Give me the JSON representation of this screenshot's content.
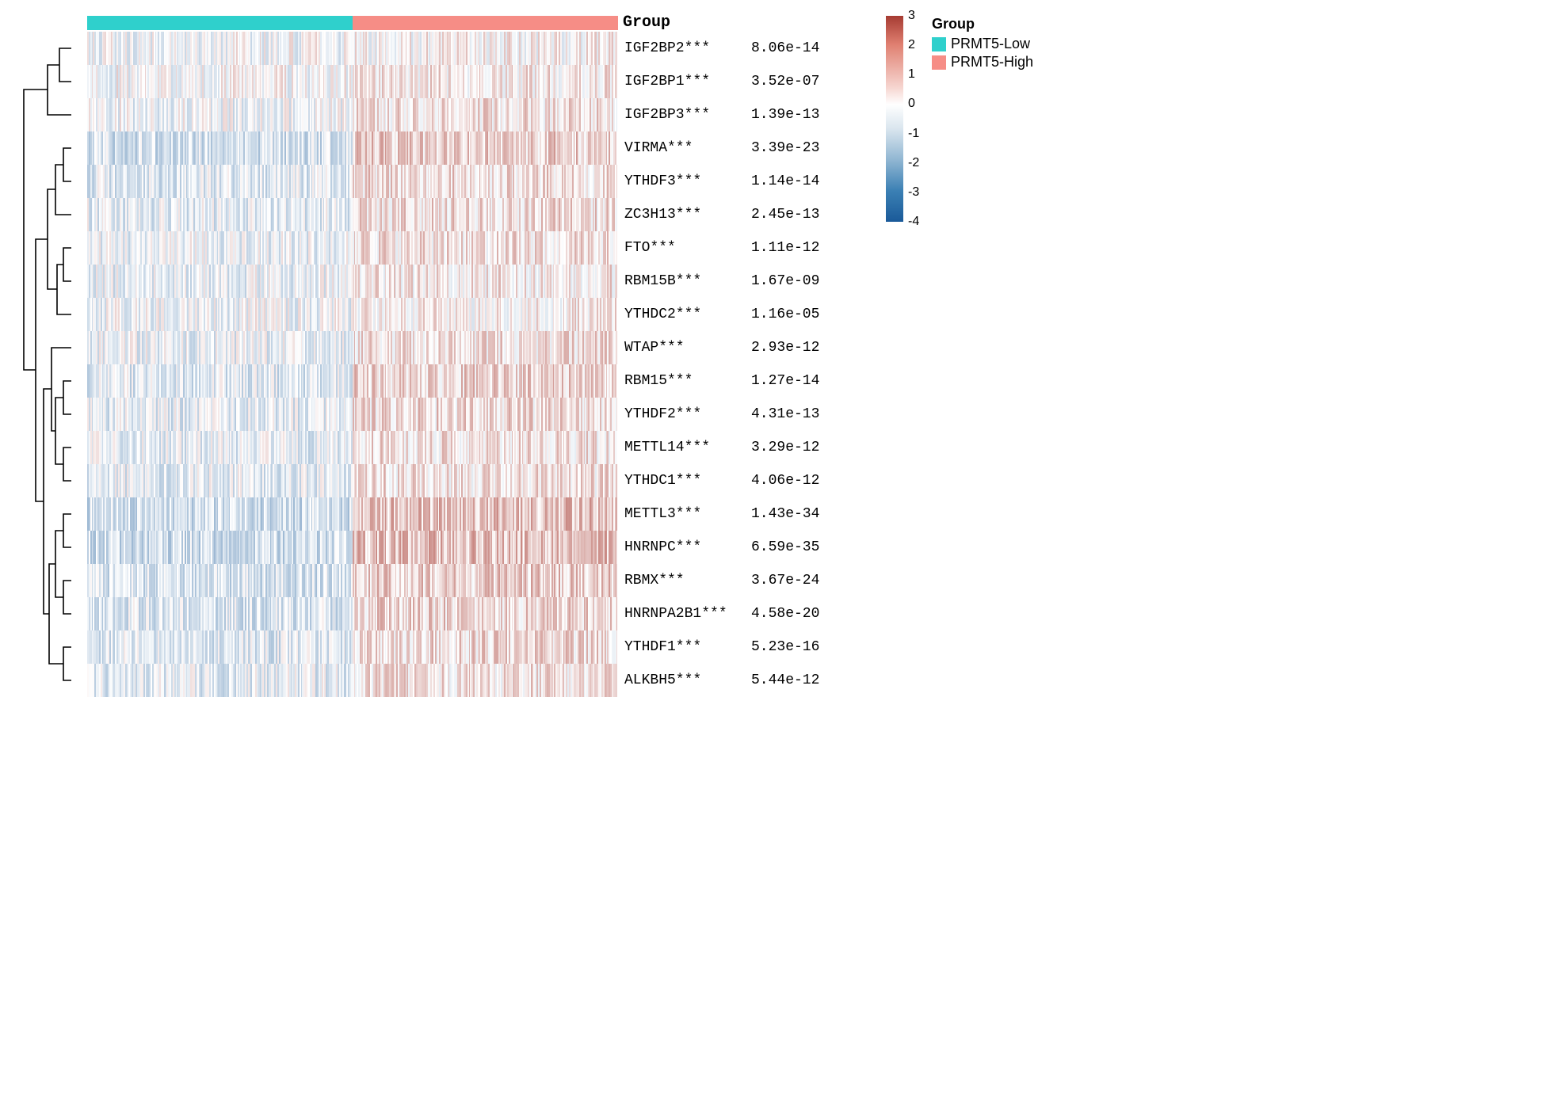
{
  "chart_data": {
    "type": "heatmap",
    "column_annotation": {
      "name": "Group",
      "categories": [
        "PRMT5-Low",
        "PRMT5-High"
      ],
      "colors": [
        "#2fd0cc",
        "#f68d86"
      ],
      "split_fraction": 0.5
    },
    "color_scale": {
      "min": -4,
      "max": 3,
      "ticks": [
        3,
        2,
        1,
        0,
        -1,
        -2,
        -3,
        -4
      ],
      "low_color": "#1a5a99",
      "mid_color": "#ffffff",
      "high_color": "#a63b32"
    },
    "rows": [
      {
        "gene": "IGF2BP2",
        "sig": "***",
        "pvalue": "8.06e-14",
        "left_mean": -0.1,
        "right_mean": 0.1,
        "dominant_half": "none"
      },
      {
        "gene": "IGF2BP1",
        "sig": "***",
        "pvalue": "3.52e-07",
        "left_mean": -0.05,
        "right_mean": 0.3,
        "dominant_half": "right"
      },
      {
        "gene": "IGF2BP3",
        "sig": "***",
        "pvalue": "1.39e-13",
        "left_mean": -0.2,
        "right_mean": 0.4,
        "dominant_half": "right"
      },
      {
        "gene": "VIRMA",
        "sig": "***",
        "pvalue": "3.39e-23",
        "left_mean": -0.7,
        "right_mean": 0.7,
        "dominant_half": "right"
      },
      {
        "gene": "YTHDF3",
        "sig": "***",
        "pvalue": "1.14e-14",
        "left_mean": -0.5,
        "right_mean": 0.5,
        "dominant_half": "right"
      },
      {
        "gene": "ZC3H13",
        "sig": "***",
        "pvalue": "2.45e-13",
        "left_mean": -0.4,
        "right_mean": 0.5,
        "dominant_half": "right"
      },
      {
        "gene": "FTO",
        "sig": "***",
        "pvalue": "1.11e-12",
        "left_mean": -0.3,
        "right_mean": 0.4,
        "dominant_half": "right"
      },
      {
        "gene": "RBM15B",
        "sig": "***",
        "pvalue": "1.67e-09",
        "left_mean": -0.3,
        "right_mean": 0.3,
        "dominant_half": "right"
      },
      {
        "gene": "YTHDC2",
        "sig": "***",
        "pvalue": "1.16e-05",
        "left_mean": -0.2,
        "right_mean": 0.2,
        "dominant_half": "right"
      },
      {
        "gene": "WTAP",
        "sig": "***",
        "pvalue": "2.93e-12",
        "left_mean": -0.3,
        "right_mean": 0.4,
        "dominant_half": "right"
      },
      {
        "gene": "RBM15",
        "sig": "***",
        "pvalue": "1.27e-14",
        "left_mean": -0.5,
        "right_mean": 0.6,
        "dominant_half": "right"
      },
      {
        "gene": "YTHDF2",
        "sig": "***",
        "pvalue": "4.31e-13",
        "left_mean": -0.4,
        "right_mean": 0.5,
        "dominant_half": "right"
      },
      {
        "gene": "METTL14",
        "sig": "***",
        "pvalue": "3.29e-12",
        "left_mean": -0.4,
        "right_mean": 0.4,
        "dominant_half": "right"
      },
      {
        "gene": "YTHDC1",
        "sig": "***",
        "pvalue": "4.06e-12",
        "left_mean": -0.4,
        "right_mean": 0.4,
        "dominant_half": "right"
      },
      {
        "gene": "METTL3",
        "sig": "***",
        "pvalue": "1.43e-34",
        "left_mean": -0.8,
        "right_mean": 0.9,
        "dominant_half": "right"
      },
      {
        "gene": "HNRNPC",
        "sig": "***",
        "pvalue": "6.59e-35",
        "left_mean": -0.8,
        "right_mean": 0.9,
        "dominant_half": "right"
      },
      {
        "gene": "RBMX",
        "sig": "***",
        "pvalue": "3.67e-24",
        "left_mean": -0.7,
        "right_mean": 0.7,
        "dominant_half": "right"
      },
      {
        "gene": "HNRNPA2B1",
        "sig": "***",
        "pvalue": "4.58e-20",
        "left_mean": -0.6,
        "right_mean": 0.6,
        "dominant_half": "right"
      },
      {
        "gene": "YTHDF1",
        "sig": "***",
        "pvalue": "5.23e-16",
        "left_mean": -0.5,
        "right_mean": 0.5,
        "dominant_half": "right"
      },
      {
        "gene": "ALKBH5",
        "sig": "***",
        "pvalue": "5.44e-12",
        "left_mean": -0.4,
        "right_mean": 0.4,
        "dominant_half": "right"
      }
    ],
    "row_dendrogram": {
      "description": "hierarchical clustering of genes",
      "clusters": [
        {
          "members": [
            "IGF2BP2",
            "IGF2BP1",
            "IGF2BP3"
          ],
          "height": 0.55
        },
        {
          "members": [
            "VIRMA",
            "YTHDF3",
            "ZC3H13",
            "FTO",
            "RBM15B",
            "YTHDC2"
          ],
          "height": 0.45
        },
        {
          "members": [
            "WTAP",
            "RBM15",
            "YTHDF2",
            "METTL14",
            "YTHDC1"
          ],
          "height": 0.4
        },
        {
          "members": [
            "METTL3",
            "HNRNPC",
            "RBMX",
            "HNRNPA2B1"
          ],
          "height": 0.35
        },
        {
          "members": [
            "YTHDF1",
            "ALKBH5"
          ],
          "height": 0.25
        }
      ]
    },
    "n_columns_per_group_approx": 180
  },
  "labels": {
    "group_annotation_title": "Group",
    "legend_title": "Group",
    "legend_items": [
      "PRMT5-Low",
      "PRMT5-High"
    ]
  }
}
